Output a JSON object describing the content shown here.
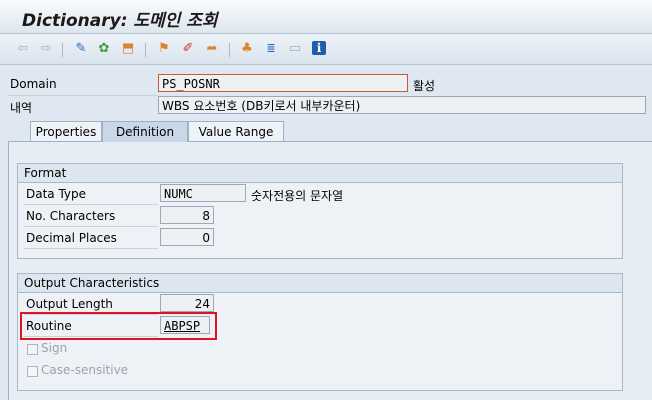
{
  "window": {
    "title": "Dictionary: 도메인 조회"
  },
  "toolbar": {
    "icons": [
      "back-arrow-icon",
      "forward-arrow-icon",
      "display-change-icon",
      "other-object-icon",
      "activate-icon",
      "where-used-icon",
      "object-list-icon",
      "transport-icon",
      "hierarchy-icon",
      "print-icon",
      "layout-icon",
      "info-icon"
    ],
    "info_glyph": "i"
  },
  "header": {
    "domain_label": "Domain",
    "domain_value": "PS_POSNR",
    "status": "활성",
    "desc_label": "내역",
    "desc_value": "WBS 요소번호 (DB키로서 내부카운터)"
  },
  "tabs": [
    {
      "label": "Properties",
      "active": false
    },
    {
      "label": "Definition",
      "active": true
    },
    {
      "label": "Value Range",
      "active": false
    }
  ],
  "format": {
    "heading": "Format",
    "data_type_label": "Data Type",
    "data_type_value": "NUMC",
    "data_type_desc": "숫자전용의 문자열",
    "no_chars_label": "No. Characters",
    "no_chars_value": "8",
    "decimals_label": "Decimal Places",
    "decimals_value": "0"
  },
  "output": {
    "heading": "Output Characteristics",
    "length_label": "Output Length",
    "length_value": "24",
    "routine_label": "Routine",
    "routine_value": "ABPSP",
    "sign_label": "Sign",
    "sign_checked": false,
    "case_label": "Case-sensitive",
    "case_checked": false
  },
  "colors": {
    "highlight": "#e0141e",
    "panel": "#dfe8f1"
  }
}
